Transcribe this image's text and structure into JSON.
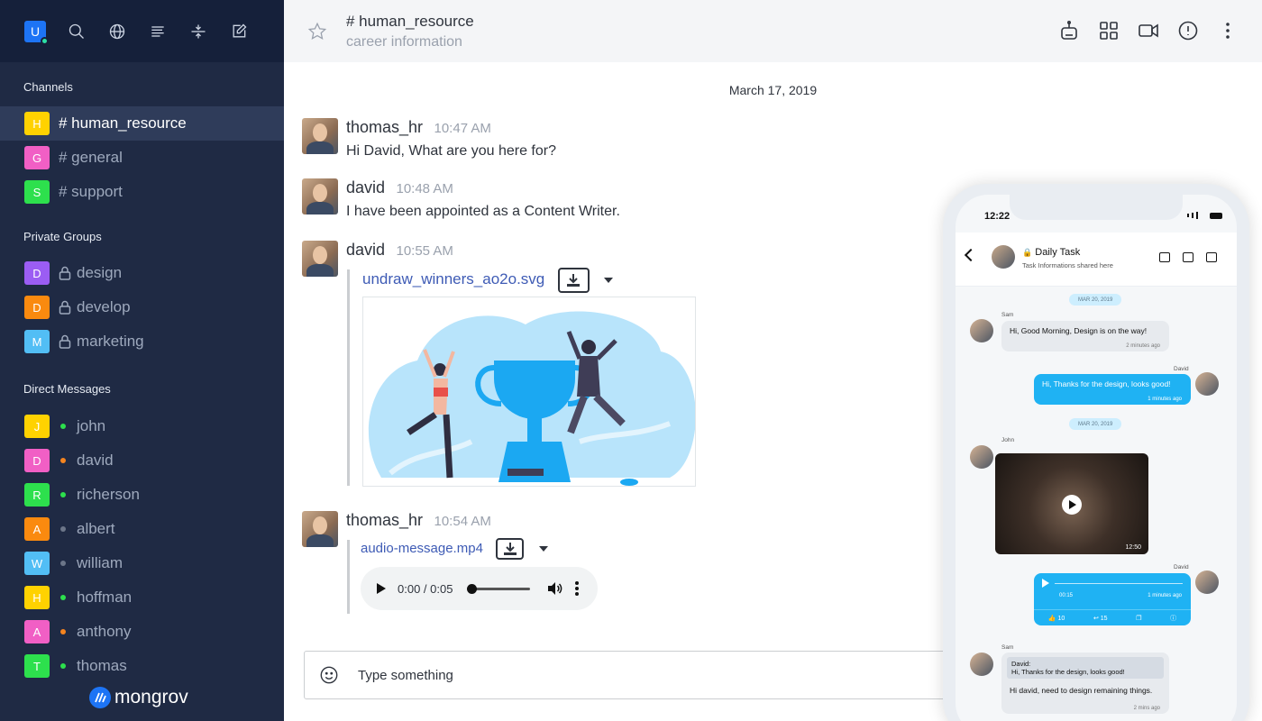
{
  "user": {
    "initial": "U"
  },
  "sections": {
    "channels": "Channels",
    "private_groups": "Private Groups",
    "direct_messages": "Direct Messages"
  },
  "channels": [
    {
      "initial": "H",
      "name": "# human_resource",
      "color": "#ffd200",
      "active": true
    },
    {
      "initial": "G",
      "name": "# general",
      "color": "#f15fc5"
    },
    {
      "initial": "S",
      "name": "# support",
      "color": "#2de04d"
    }
  ],
  "private_groups": [
    {
      "initial": "D",
      "name": "design",
      "color": "#9b5df3"
    },
    {
      "initial": "D",
      "name": "develop",
      "color": "#fa8a0f"
    },
    {
      "initial": "M",
      "name": "marketing",
      "color": "#52bef5"
    }
  ],
  "direct_messages": [
    {
      "initial": "J",
      "name": "john",
      "color": "#ffd200",
      "status": "#2de04d"
    },
    {
      "initial": "D",
      "name": "david",
      "color": "#f15fc5",
      "status": "#f5841f"
    },
    {
      "initial": "R",
      "name": "richerson",
      "color": "#2de04d",
      "status": "#2de04d"
    },
    {
      "initial": "A",
      "name": "albert",
      "color": "#fa8a0f",
      "status": "#6c7689"
    },
    {
      "initial": "W",
      "name": "william",
      "color": "#52bef5",
      "status": "#6c7689"
    },
    {
      "initial": "H",
      "name": "hoffman",
      "color": "#ffd200",
      "status": "#2de04d"
    },
    {
      "initial": "A",
      "name": "anthony",
      "color": "#f15fc5",
      "status": "#f5841f"
    },
    {
      "initial": "T",
      "name": "thomas",
      "color": "#2de04d",
      "status": "#2de04d"
    }
  ],
  "brand": {
    "name": "mongrov"
  },
  "header": {
    "title": "# human_resource",
    "subtitle": "career information"
  },
  "date_separator": "March 17, 2019",
  "messages": [
    {
      "user": "thomas_hr",
      "time": "10:47 AM",
      "text": "Hi David, What are you here for?"
    },
    {
      "user": "david",
      "time": "10:48 AM",
      "text": "I have been appointed as a Content Writer."
    },
    {
      "user": "david",
      "time": "10:55 AM",
      "attachment": "undraw_winners_ao2o.svg"
    },
    {
      "user": "thomas_hr",
      "time": "10:54 AM",
      "attachment": "audio-message.mp4"
    }
  ],
  "audio": {
    "time": "0:00 / 0:05"
  },
  "composer": {
    "placeholder": "Type something"
  },
  "phone": {
    "time": "12:22",
    "title": "Daily Task",
    "subtitle": "Task Informations shared here",
    "date1": "MAR 20, 2019",
    "date2": "MAR 20, 2019",
    "m1_name": "Sam",
    "m1_text": "Hi, Good Morning, Design is on the way!",
    "m1_time": "2 minutes ago",
    "m2_name": "David",
    "m2_text": "Hi, Thanks for the design, looks good!",
    "m2_time": "1 minutes ago",
    "m3_name": "John",
    "video_duration": "12:50",
    "m4_name": "David",
    "voice_elapsed": "00:15",
    "voice_time": "1 minutes ago",
    "likes": "10",
    "replies": "15",
    "m5_name": "Sam",
    "quote_author": "David:",
    "quote_text": "Hi, Thanks for the design, looks good!",
    "m5_text": "Hi david, need to design remaining things.",
    "m5_time": "2 mins ago"
  }
}
